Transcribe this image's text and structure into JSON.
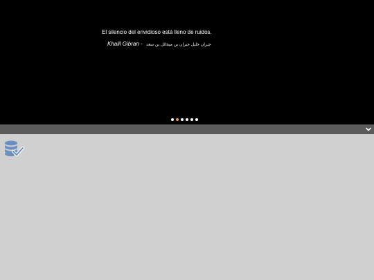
{
  "slider": {
    "quote": "El silencio del envidioso está lleno de ruidos.",
    "author": "Khalil Gibran - ",
    "author_arabic": "جبران خليل جبران بن ميخائل بن سعد",
    "dots": [
      {
        "active": false
      },
      {
        "active": true
      },
      {
        "active": false
      },
      {
        "active": false
      },
      {
        "active": false
      },
      {
        "active": false
      }
    ],
    "active_dot_color": "#e8a04a"
  },
  "toggle_bar": {
    "icon": "chevron-down-icon"
  },
  "content": {
    "icon": "database-check-icon"
  }
}
